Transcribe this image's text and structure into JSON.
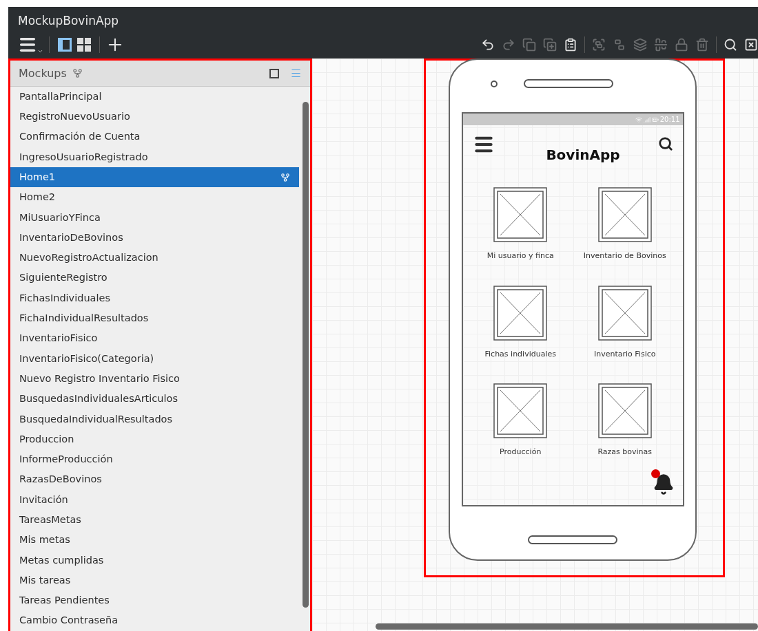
{
  "window": {
    "title": "MockupBovinApp"
  },
  "toolbar": {
    "view_toggles": [
      {
        "kind": "single",
        "selected": true
      },
      {
        "kind": "grid",
        "selected": false
      }
    ],
    "tools": [
      {
        "kind": "undo",
        "disabled": false
      },
      {
        "kind": "redo",
        "disabled": true
      },
      {
        "kind": "copy",
        "disabled": true
      },
      {
        "kind": "duplicate",
        "disabled": true
      },
      {
        "kind": "paste",
        "disabled": false
      },
      {
        "kind": "group",
        "disabled": true
      },
      {
        "kind": "ungroup",
        "disabled": true
      },
      {
        "kind": "arrange",
        "disabled": true
      },
      {
        "kind": "align",
        "disabled": true
      },
      {
        "kind": "lock",
        "disabled": true
      },
      {
        "kind": "delete",
        "disabled": true
      },
      {
        "kind": "search",
        "disabled": false
      },
      {
        "kind": "close",
        "disabled": false
      }
    ]
  },
  "sidebar": {
    "title": "Mockups",
    "items": [
      {
        "label": "PantallaPrincipal",
        "selected": false
      },
      {
        "label": "RegistroNuevoUsuario",
        "selected": false
      },
      {
        "label": "Confirmación de Cuenta",
        "selected": false
      },
      {
        "label": "IngresoUsuarioRegistrado",
        "selected": false
      },
      {
        "label": "Home1",
        "selected": true
      },
      {
        "label": "Home2",
        "selected": false
      },
      {
        "label": "MiUsuarioYFinca",
        "selected": false
      },
      {
        "label": "InventarioDeBovinos",
        "selected": false
      },
      {
        "label": "NuevoRegistroActualizacion",
        "selected": false
      },
      {
        "label": "SiguienteRegistro",
        "selected": false
      },
      {
        "label": "FichasIndividuales",
        "selected": false
      },
      {
        "label": "FichaIndividualResultados",
        "selected": false
      },
      {
        "label": "InventarioFisico",
        "selected": false
      },
      {
        "label": "InventarioFisico(Categoria)",
        "selected": false
      },
      {
        "label": "Nuevo Registro Inventario Fisico",
        "selected": false
      },
      {
        "label": "BusquedasIndividualesArticulos",
        "selected": false
      },
      {
        "label": "BusquedaIndividualResultados",
        "selected": false
      },
      {
        "label": "Produccion",
        "selected": false
      },
      {
        "label": "InformeProducción",
        "selected": false
      },
      {
        "label": "RazasDeBovinos",
        "selected": false
      },
      {
        "label": "Invitación",
        "selected": false
      },
      {
        "label": "TareasMetas",
        "selected": false
      },
      {
        "label": "Mis metas",
        "selected": false
      },
      {
        "label": "Metas cumplidas",
        "selected": false
      },
      {
        "label": "Mis tareas",
        "selected": false
      },
      {
        "label": "Tareas Pendientes",
        "selected": false
      },
      {
        "label": "Cambio Contraseña",
        "selected": false
      }
    ]
  },
  "phone": {
    "status_time": "20:11",
    "app_title": "BovinApp",
    "tiles": [
      {
        "label": "Mi usuario y finca"
      },
      {
        "label": "Inventario de Bovinos"
      },
      {
        "label": "Fichas individuales"
      },
      {
        "label": "Inventario Fisico"
      },
      {
        "label": "Producción"
      },
      {
        "label": "Razas bovinas"
      }
    ],
    "notification": true
  }
}
